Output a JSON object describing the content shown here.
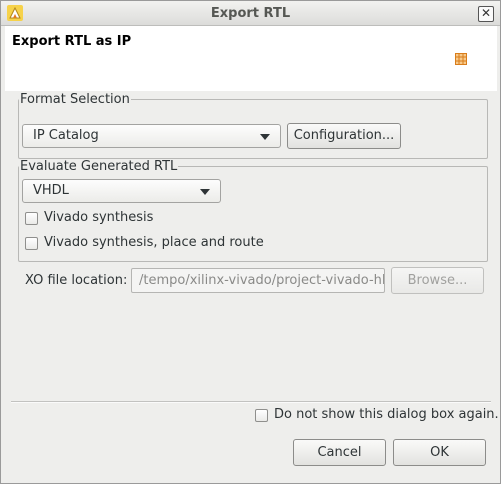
{
  "window": {
    "title": "Export RTL",
    "close_glyph": "✕"
  },
  "header": {
    "title": "Export RTL as IP"
  },
  "format_selection": {
    "legend": "Format Selection",
    "format_combo": {
      "selected": "IP Catalog"
    },
    "configuration_button": "Configuration..."
  },
  "evaluate": {
    "legend": "Evaluate Generated RTL",
    "language_combo": {
      "selected": "VHDL"
    },
    "options": [
      {
        "label": "Vivado synthesis",
        "checked": false
      },
      {
        "label": "Vivado synthesis, place and route",
        "checked": false
      }
    ]
  },
  "xo": {
    "label": "XO file location:",
    "value": "/tempo/xilinx-vivado/project-vivado-hl",
    "browse_button": "Browse..."
  },
  "footer": {
    "dont_show_label": "Do not show this dialog box again.",
    "dont_show_checked": false,
    "cancel_label": "Cancel",
    "ok_label": "OK"
  },
  "icons": {
    "app": "vivado-hls-logo-icon",
    "header": "ip-grid-icon",
    "close": "close-icon",
    "combo": "chevron-down-icon"
  },
  "colors": {
    "accent_orange": "#e07a1f",
    "header_bg": "#ffffff",
    "dialog_bg": "#eeeeec"
  }
}
